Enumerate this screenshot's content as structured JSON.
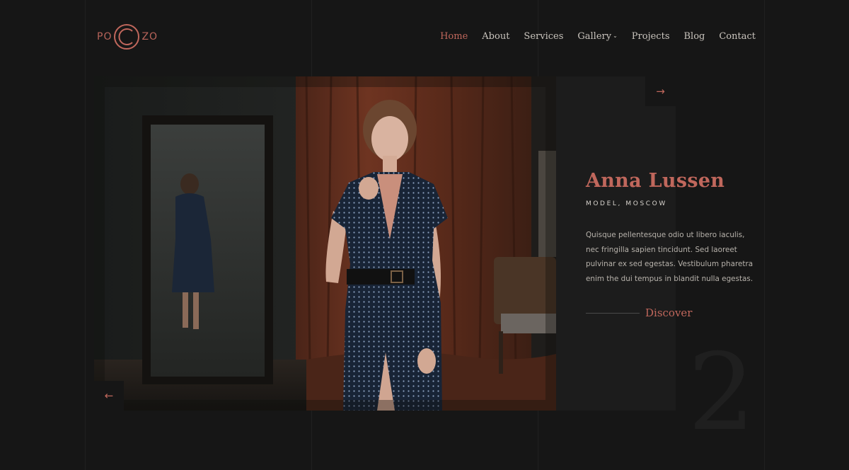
{
  "brand": {
    "left_text": "PO",
    "right_text": "ZO",
    "accent_color": "#c0675c"
  },
  "nav": {
    "items": [
      {
        "label": "Home",
        "active": true
      },
      {
        "label": "About"
      },
      {
        "label": "Services"
      },
      {
        "label": "Gallery",
        "has_dropdown": true,
        "caret_icon": "chevron-down-icon"
      },
      {
        "label": "Projects"
      },
      {
        "label": "Blog"
      },
      {
        "label": "Contact"
      }
    ]
  },
  "slide": {
    "image": "model-portrait-photo",
    "name": "Anna Lussen",
    "role": "MODEL, MOSCOW",
    "description": "Quisque pellentesque odio ut libero iaculis, nec fringilla sapien tincidunt. Sed laoreet pulvinar ex sed egestas. Vestibulum pharetra enim the dui tempus in blandit nulla egestas.",
    "cta_label": "Discover",
    "number": "2",
    "next_icon": "arrow-right-icon",
    "next_glyph": "→",
    "prev_icon": "arrow-left-icon",
    "prev_glyph": "←"
  }
}
